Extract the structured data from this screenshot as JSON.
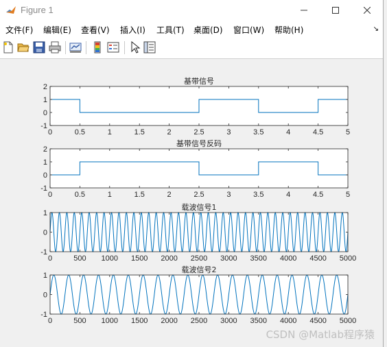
{
  "window": {
    "title": "Figure 1"
  },
  "menu": [
    {
      "label": "文件(F)"
    },
    {
      "label": "编辑(E)"
    },
    {
      "label": "查看(V)"
    },
    {
      "label": "插入(I)"
    },
    {
      "label": "工具(T)"
    },
    {
      "label": "桌面(D)"
    },
    {
      "label": "窗口(W)"
    },
    {
      "label": "帮助(H)"
    }
  ],
  "menu_overflow_icon": "↘",
  "toolbar": [
    {
      "icon": "new-figure-icon"
    },
    {
      "icon": "open-folder-icon"
    },
    {
      "icon": "save-icon"
    },
    {
      "icon": "print-icon"
    },
    {
      "icon": "link-plot-icon"
    },
    {
      "icon": "colorbar-icon"
    },
    {
      "icon": "legend-icon"
    },
    {
      "icon": "select-pointer-icon"
    },
    {
      "icon": "property-inspector-icon"
    }
  ],
  "colors": {
    "line": "#0072bd",
    "axes": "#262626",
    "grid_bg": "#ffffff"
  },
  "watermark": "CSDN @Matlab程序猿",
  "chart_data": [
    {
      "type": "line",
      "title": "基带信号",
      "style": "step",
      "xlim": [
        0,
        5
      ],
      "ylim": [
        -1,
        2
      ],
      "xticks": [
        "0",
        "0.5",
        "1",
        "1.5",
        "2",
        "2.5",
        "3",
        "3.5",
        "4",
        "4.5",
        "5"
      ],
      "yticks": [
        "-1",
        "0",
        "1",
        "2"
      ],
      "x": [
        0,
        0.5,
        2.5,
        3.5,
        4.5,
        5
      ],
      "y": [
        1,
        0,
        1,
        0,
        1,
        1
      ],
      "bits": [
        1,
        0,
        0,
        0,
        0,
        1,
        1,
        0,
        0,
        1
      ]
    },
    {
      "type": "line",
      "title": "基带信号反码",
      "style": "step",
      "xlim": [
        0,
        5
      ],
      "ylim": [
        -1,
        2
      ],
      "xticks": [
        "0",
        "0.5",
        "1",
        "1.5",
        "2",
        "2.5",
        "3",
        "3.5",
        "4",
        "4.5",
        "5"
      ],
      "yticks": [
        "-1",
        "0",
        "1",
        "2"
      ],
      "x": [
        0,
        0.5,
        2.5,
        3.5,
        4.5,
        5
      ],
      "y": [
        0,
        1,
        0,
        1,
        0,
        0
      ],
      "bits": [
        0,
        1,
        1,
        1,
        1,
        0,
        0,
        1,
        1,
        0
      ]
    },
    {
      "type": "line",
      "title": "载波信号1",
      "style": "sine",
      "xlim": [
        0,
        5000
      ],
      "ylim": [
        -1,
        1
      ],
      "xticks": [
        "0",
        "500",
        "1000",
        "1500",
        "2000",
        "2500",
        "3000",
        "3500",
        "4000",
        "4500",
        "5000"
      ],
      "yticks": [
        "-1",
        "0",
        "1"
      ],
      "cycles": 40
    },
    {
      "type": "line",
      "title": "载波信号2",
      "style": "sine",
      "xlim": [
        0,
        5000
      ],
      "ylim": [
        -1,
        1
      ],
      "xticks": [
        "0",
        "500",
        "1000",
        "1500",
        "2000",
        "2500",
        "3000",
        "3500",
        "4000",
        "4500",
        "5000"
      ],
      "yticks": [
        "-1",
        "0",
        "1"
      ],
      "cycles": 20
    }
  ]
}
